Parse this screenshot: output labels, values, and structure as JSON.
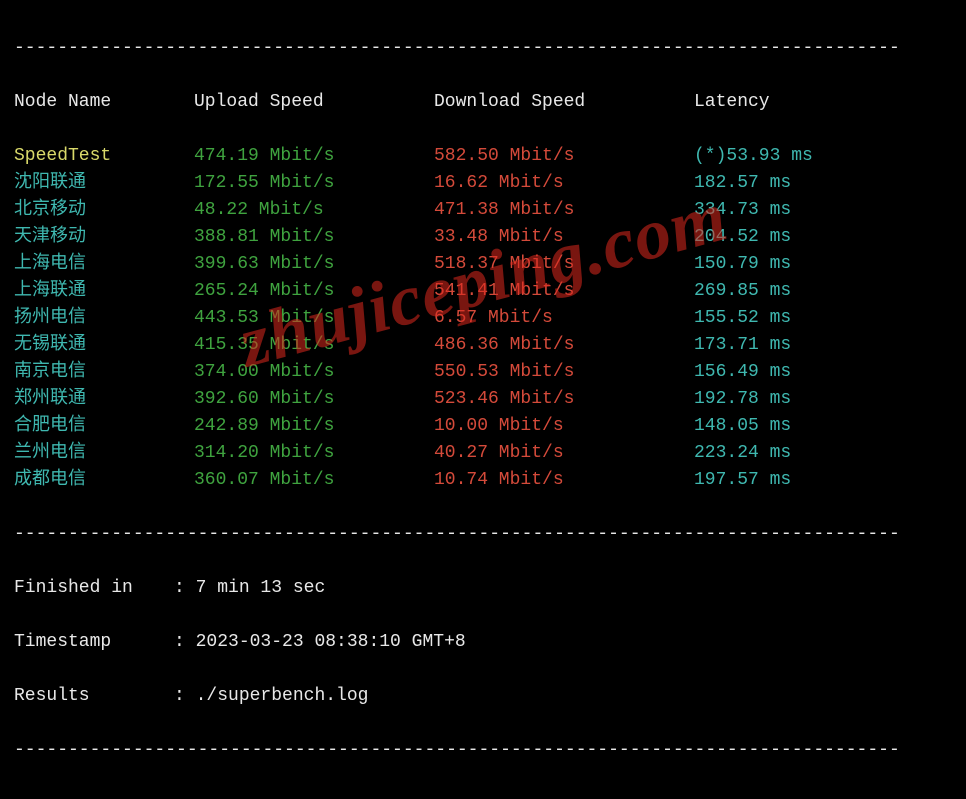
{
  "chart_data": {
    "type": "table",
    "columns": [
      "Node Name",
      "Upload Speed",
      "Download Speed",
      "Latency"
    ],
    "rows": [
      {
        "node": "SpeedTest",
        "upload": "474.19 Mbit/s",
        "download": "582.50 Mbit/s",
        "latency": "(*)53.93 ms",
        "highlight": true
      },
      {
        "node": "沈阳联通",
        "upload": "172.55 Mbit/s",
        "download": "16.62 Mbit/s",
        "latency": "182.57 ms"
      },
      {
        "node": "北京移动",
        "upload": "48.22 Mbit/s",
        "download": "471.38 Mbit/s",
        "latency": "334.73 ms"
      },
      {
        "node": "天津移动",
        "upload": "388.81 Mbit/s",
        "download": "33.48 Mbit/s",
        "latency": "204.52 ms"
      },
      {
        "node": "上海电信",
        "upload": "399.63 Mbit/s",
        "download": "518.37 Mbit/s",
        "latency": "150.79 ms"
      },
      {
        "node": "上海联通",
        "upload": "265.24 Mbit/s",
        "download": "541.41 Mbit/s",
        "latency": "269.85 ms"
      },
      {
        "node": "扬州电信",
        "upload": "443.53 Mbit/s",
        "download": "6.57 Mbit/s",
        "latency": "155.52 ms"
      },
      {
        "node": "无锡联通",
        "upload": "415.35 Mbit/s",
        "download": "486.36 Mbit/s",
        "latency": "173.71 ms"
      },
      {
        "node": "南京电信",
        "upload": "374.00 Mbit/s",
        "download": "550.53 Mbit/s",
        "latency": "156.49 ms"
      },
      {
        "node": "郑州联通",
        "upload": "392.60 Mbit/s",
        "download": "523.46 Mbit/s",
        "latency": "192.78 ms"
      },
      {
        "node": "合肥电信",
        "upload": "242.89 Mbit/s",
        "download": "10.00 Mbit/s",
        "latency": "148.05 ms"
      },
      {
        "node": "兰州电信",
        "upload": "314.20 Mbit/s",
        "download": "40.27 Mbit/s",
        "latency": "223.24 ms"
      },
      {
        "node": "成都电信",
        "upload": "360.07 Mbit/s",
        "download": "10.74 Mbit/s",
        "latency": "197.57 ms"
      }
    ]
  },
  "headers": {
    "node": "Node Name",
    "upload": "Upload Speed",
    "download": "Download Speed",
    "latency": "Latency"
  },
  "dash_line": "----------------------------------------------------------------------------------",
  "footer": {
    "finished_label": "Finished in",
    "finished_value": "7 min 13 sec",
    "timestamp_label": "Timestamp",
    "timestamp_value": "2023-03-23 08:38:10 GMT+8",
    "results_label": "Results",
    "results_value": "./superbench.log",
    "sep": ":"
  },
  "watermark": "zhujiceping.com"
}
